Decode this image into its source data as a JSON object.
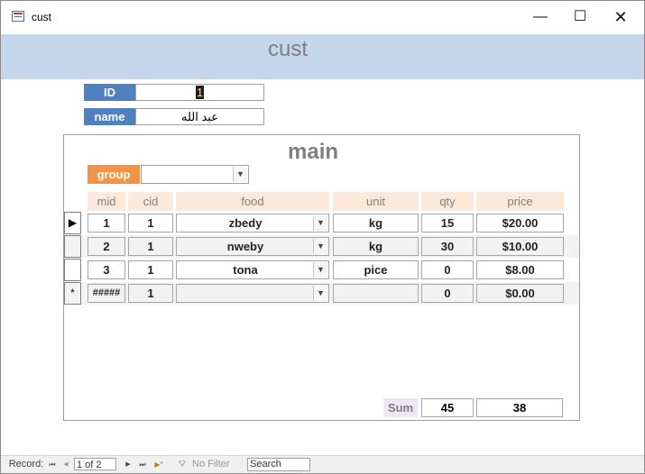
{
  "window": {
    "title": "cust",
    "minimize_glyph": "—",
    "maximize_glyph": "☐",
    "close_glyph": "✕"
  },
  "form": {
    "title": "cust",
    "id_label": "ID",
    "id_value": "1",
    "name_label": "name",
    "name_value": "عبد الله"
  },
  "subform": {
    "title": "main",
    "group_label": "group",
    "group_value": "",
    "columns": [
      "mid",
      "cid",
      "food",
      "unit",
      "qty",
      "price"
    ],
    "rows": [
      {
        "selector": "▶",
        "mid": "1",
        "cid": "1",
        "food": "zbedy",
        "unit": "kg",
        "qty": "15",
        "price": "$20.00"
      },
      {
        "selector": "",
        "mid": "2",
        "cid": "1",
        "food": "nweby",
        "unit": "kg",
        "qty": "30",
        "price": "$10.00"
      },
      {
        "selector": "",
        "mid": "3",
        "cid": "1",
        "food": "tona",
        "unit": "pice",
        "qty": "0",
        "price": "$8.00"
      },
      {
        "selector": "*",
        "mid": "#####",
        "cid": "1",
        "food": "",
        "unit": "",
        "qty": "0",
        "price": "$0.00"
      }
    ],
    "sum_label": "Sum",
    "sum_qty": "45",
    "sum_price": "38"
  },
  "navbar": {
    "record_label": "Record:",
    "first_glyph": "⏮",
    "prev_glyph": "◀",
    "position": "1 of 2",
    "next_glyph": "▶",
    "last_glyph": "⏭",
    "new_glyph": "▶*",
    "filter_label": "No Filter",
    "search_label": "Search"
  }
}
